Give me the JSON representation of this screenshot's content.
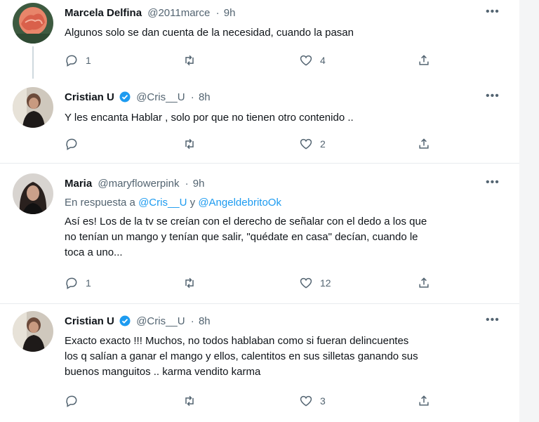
{
  "tweets": [
    {
      "name": "Marcela Delfina",
      "handle": "@2011marce",
      "time": "9h",
      "text": "Algunos solo se dan cuenta de la necesidad, cuando la pasan",
      "replies": "1",
      "retweets": "",
      "likes": "4",
      "verified": false
    },
    {
      "name": "Cristian U",
      "handle": "@Cris__U",
      "time": "8h",
      "text": "Y les encanta Hablar , solo por que no tienen otro contenido ..",
      "replies": "",
      "retweets": "",
      "likes": "2",
      "verified": true
    },
    {
      "name": "Maria",
      "handle": "@maryflowerpink",
      "time": "9h",
      "reply_prefix": "En respuesta a",
      "reply_mention_1": "@Cris__U",
      "reply_and": "y",
      "reply_mention_2": "@AngeldebritoOk",
      "text_line_1": "Así es! Los de la tv se creían con el derecho de señalar con el dedo a los que",
      "text_line_2": "no tenían un mango y tenían que salir, \"quédate en casa\" decían, cuando le",
      "text_line_3": "toca a uno...",
      "replies": "1",
      "retweets": "",
      "likes": "12",
      "verified": false
    },
    {
      "name": "Cristian U",
      "handle": "@Cris__U",
      "time": "8h",
      "text_line_1": "Exacto exacto !!! Muchos, no todos hablaban como si fueran delincuentes",
      "text_line_2": "los q salían a ganar el mango y ellos, calentitos en sus silletas ganando sus",
      "text_line_3": "buenos manguitos .. karma vendito karma",
      "replies": "",
      "retweets": "",
      "likes": "3",
      "verified": true
    }
  ],
  "colors": {
    "accent": "#1d9bf0",
    "secondary_text": "#536471",
    "primary_text": "#0f1419"
  },
  "icons": [
    "reply-icon",
    "retweet-icon",
    "like-icon",
    "share-icon",
    "more-icon",
    "verified-badge-icon"
  ]
}
